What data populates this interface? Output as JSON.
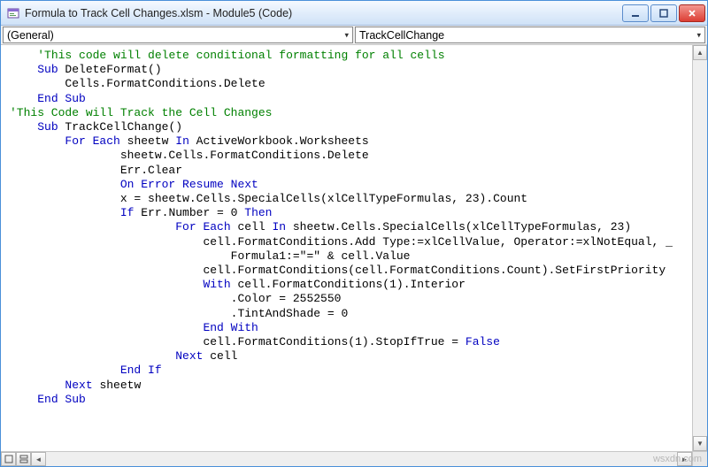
{
  "window": {
    "title": "Formula to Track Cell Changes.xlsm - Module5 (Code)",
    "icon_name": "vba-module-icon"
  },
  "dropdowns": {
    "object": "(General)",
    "procedure": "TrackCellChange"
  },
  "code": {
    "lines": [
      {
        "indent": 1,
        "tokens": [
          {
            "t": "'This code will delete conditional formatting for all cells",
            "c": "c-comment"
          }
        ]
      },
      {
        "indent": 1,
        "tokens": [
          {
            "t": "Sub",
            "c": "c-kw"
          },
          {
            "t": " DeleteFormat()"
          }
        ]
      },
      {
        "indent": 2,
        "tokens": [
          {
            "t": "Cells.FormatConditions.Delete"
          }
        ]
      },
      {
        "indent": 1,
        "tokens": [
          {
            "t": "End Sub",
            "c": "c-kw"
          }
        ]
      },
      {
        "indent": 0,
        "tokens": [
          {
            "t": "'This Code will Track the Cell Changes",
            "c": "c-comment"
          }
        ]
      },
      {
        "indent": 1,
        "tokens": [
          {
            "t": "Sub",
            "c": "c-kw"
          },
          {
            "t": " TrackCellChange()"
          }
        ]
      },
      {
        "indent": 2,
        "tokens": [
          {
            "t": "For Each",
            "c": "c-kw"
          },
          {
            "t": " sheetw "
          },
          {
            "t": "In",
            "c": "c-kw"
          },
          {
            "t": " ActiveWorkbook.Worksheets"
          }
        ]
      },
      {
        "indent": 4,
        "tokens": [
          {
            "t": "sheetw.Cells.FormatConditions.Delete"
          }
        ]
      },
      {
        "indent": 4,
        "tokens": [
          {
            "t": "Err.Clear"
          }
        ]
      },
      {
        "indent": 4,
        "tokens": [
          {
            "t": "On Error Resume Next",
            "c": "c-kw"
          }
        ]
      },
      {
        "indent": 4,
        "tokens": [
          {
            "t": "x = sheetw.Cells.SpecialCells(xlCellTypeFormulas, 23).Count"
          }
        ]
      },
      {
        "indent": 4,
        "tokens": [
          {
            "t": "If",
            "c": "c-kw"
          },
          {
            "t": " Err.Number = 0 "
          },
          {
            "t": "Then",
            "c": "c-kw"
          }
        ]
      },
      {
        "indent": 6,
        "tokens": [
          {
            "t": "For Each",
            "c": "c-kw"
          },
          {
            "t": " cell "
          },
          {
            "t": "In",
            "c": "c-kw"
          },
          {
            "t": " sheetw.Cells.SpecialCells(xlCellTypeFormulas, 23)"
          }
        ]
      },
      {
        "indent": 7,
        "tokens": [
          {
            "t": "cell.FormatConditions.Add Type:=xlCellValue, Operator:=xlNotEqual, _"
          }
        ]
      },
      {
        "indent": 8,
        "tokens": [
          {
            "t": "Formula1:=\"=\" & cell.Value"
          }
        ]
      },
      {
        "indent": 7,
        "tokens": [
          {
            "t": "cell.FormatConditions(cell.FormatConditions.Count).SetFirstPriority"
          }
        ]
      },
      {
        "indent": 7,
        "tokens": [
          {
            "t": "With",
            "c": "c-kw"
          },
          {
            "t": " cell.FormatConditions(1).Interior"
          }
        ]
      },
      {
        "indent": 8,
        "tokens": [
          {
            "t": ".Color = 2552550"
          }
        ]
      },
      {
        "indent": 8,
        "tokens": [
          {
            "t": ".TintAndShade = 0"
          }
        ]
      },
      {
        "indent": 7,
        "tokens": [
          {
            "t": "End With",
            "c": "c-kw"
          }
        ]
      },
      {
        "indent": 7,
        "tokens": [
          {
            "t": "cell.FormatConditions(1).StopIfTrue = "
          },
          {
            "t": "False",
            "c": "c-kw"
          }
        ]
      },
      {
        "indent": 6,
        "tokens": [
          {
            "t": "Next",
            "c": "c-kw"
          },
          {
            "t": " cell"
          }
        ]
      },
      {
        "indent": 4,
        "tokens": [
          {
            "t": "End If",
            "c": "c-kw"
          }
        ]
      },
      {
        "indent": 0,
        "tokens": [
          {
            "t": ""
          }
        ]
      },
      {
        "indent": 2,
        "tokens": [
          {
            "t": "Next",
            "c": "c-kw"
          },
          {
            "t": " sheetw"
          }
        ]
      },
      {
        "indent": 1,
        "tokens": [
          {
            "t": "End Sub",
            "c": "c-kw"
          }
        ]
      }
    ],
    "indent_unit": "    "
  },
  "watermark": "wsxdn.com"
}
